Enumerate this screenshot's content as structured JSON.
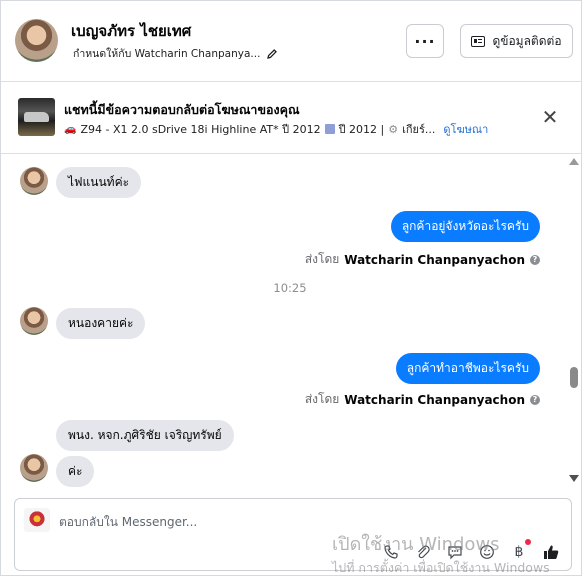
{
  "header": {
    "contact_name": "เบญจภัทร ไชยเทศ",
    "assigned_text": "กำหนดให้กับ Watcharin Chanpanya...",
    "more_label": "···",
    "info_button_label": "ดูข้อมูลติดต่อ"
  },
  "ad_banner": {
    "title": "แชทนี้มีข้อความตอบกลับต่อโฆษณาของคุณ",
    "detail_model": "Z94 - X1 2.0 sDrive 18i Highline AT* ปี 2012",
    "detail_year": "ปี 2012 |",
    "detail_gear": "เกียร์...",
    "link_label": "ดูโฆษณา",
    "close_label": "✕"
  },
  "messages": [
    {
      "direction": "in",
      "text": "ไฟแนนท์ค่ะ"
    },
    {
      "direction": "out",
      "text": "ลูกค้าอยู่จังหวัดอะไรครับ"
    },
    {
      "direction": "sent_by",
      "prefix": "ส่งโดย",
      "name": "Watcharin Chanpanyachon"
    },
    {
      "direction": "timestamp",
      "text": "10:25"
    },
    {
      "direction": "in",
      "text": "หนองคายค่ะ"
    },
    {
      "direction": "out",
      "text": "ลูกค้าทำอาชีพอะไรครับ"
    },
    {
      "direction": "sent_by",
      "prefix": "ส่งโดย",
      "name": "Watcharin Chanpanyachon"
    },
    {
      "direction": "in",
      "text": "พนง. หจก.ภูศิริชัย เจริญทรัพย์"
    },
    {
      "direction": "in",
      "text": "ค่ะ"
    }
  ],
  "composer": {
    "placeholder": "ตอบกลับใน Messenger..."
  },
  "tools": [
    "phone-icon",
    "attach-icon",
    "saved-reply-icon",
    "emoji-icon",
    "baht-icon",
    "like-icon"
  ],
  "watermark": {
    "line1": "เปิดใช้งาน Windows",
    "line2": "ไปที่ การตั้งค่า เพื่อเปิดใช้งาน Windows"
  },
  "colors": {
    "outgoing_bubble": "#0a7cff",
    "incoming_bubble": "#e4e6eb",
    "link": "#216fdb",
    "notification_dot": "#f02849"
  }
}
